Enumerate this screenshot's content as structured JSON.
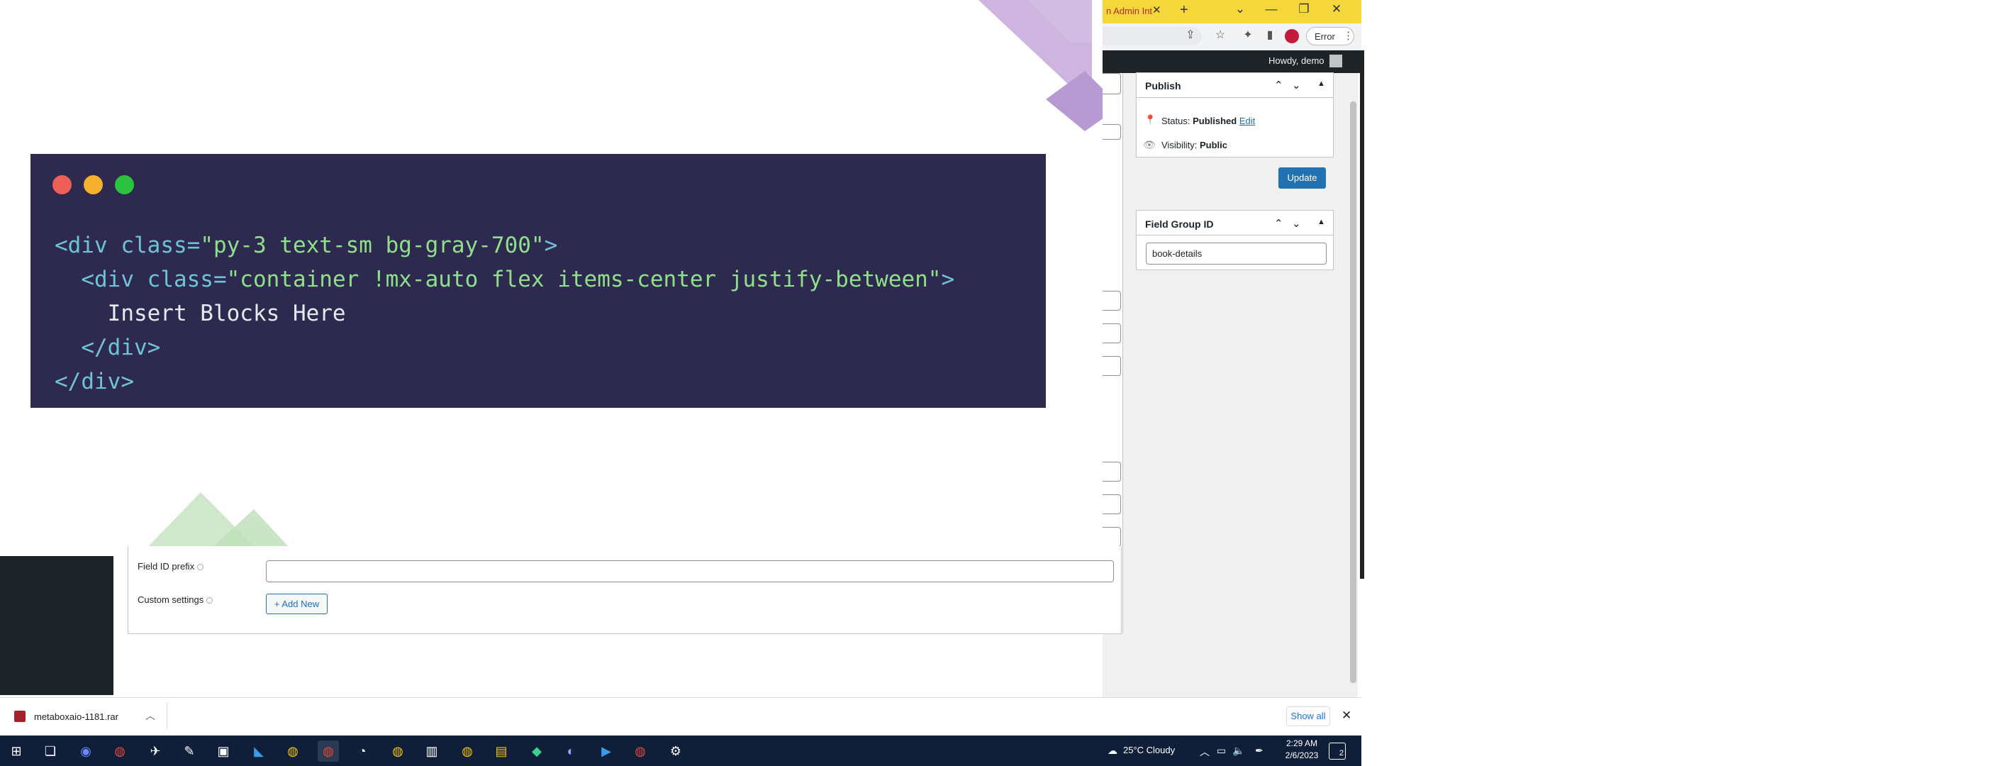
{
  "browser": {
    "tab_title": "n Admin Int",
    "new_tab_glyph": "+",
    "error_label": "Error"
  },
  "admin_bar": {
    "howdy": "Howdy, demo"
  },
  "publish_box": {
    "title": "Publish",
    "status_label": "Status:",
    "status_value": "Published",
    "edit_link": "Edit",
    "visibility_label": "Visibility:",
    "visibility_value": "Public",
    "update_button": "Update"
  },
  "field_group_box": {
    "title": "Field Group ID",
    "value": "book-details"
  },
  "form": {
    "field_id_prefix_label": "Field ID prefix",
    "custom_settings_label": "Custom settings",
    "add_new_button": "+ Add New"
  },
  "code_snippet": {
    "line1_open": "<div ",
    "line1_attr": "class=",
    "line1_str": "\"py-3 text-sm bg-gray-700\"",
    "line1_close": ">",
    "line2_open": "  <div ",
    "line2_attr": "class=",
    "line2_str": "\"container !mx-auto flex items-center justify-between\"",
    "line2_close": ">",
    "line3": "    Insert Blocks Here",
    "line4": "  </div>",
    "line5": "</div>",
    "dot_colors": [
      "#ed5f57",
      "#f5b02d",
      "#2cc13f"
    ]
  },
  "downloads_bar": {
    "file_name": "metaboxaio-1181.rar",
    "show_all": "Show all"
  },
  "taskbar": {
    "weather": "25°C  Cloudy",
    "time": "2:29 AM",
    "date": "2/6/2023",
    "notification_count": "2"
  },
  "colors": {
    "wp_blue": "#2271b1",
    "admin_bar": "#1d2327",
    "tab_strip": "#f5d73b",
    "code_bg": "#2e2a4f"
  }
}
